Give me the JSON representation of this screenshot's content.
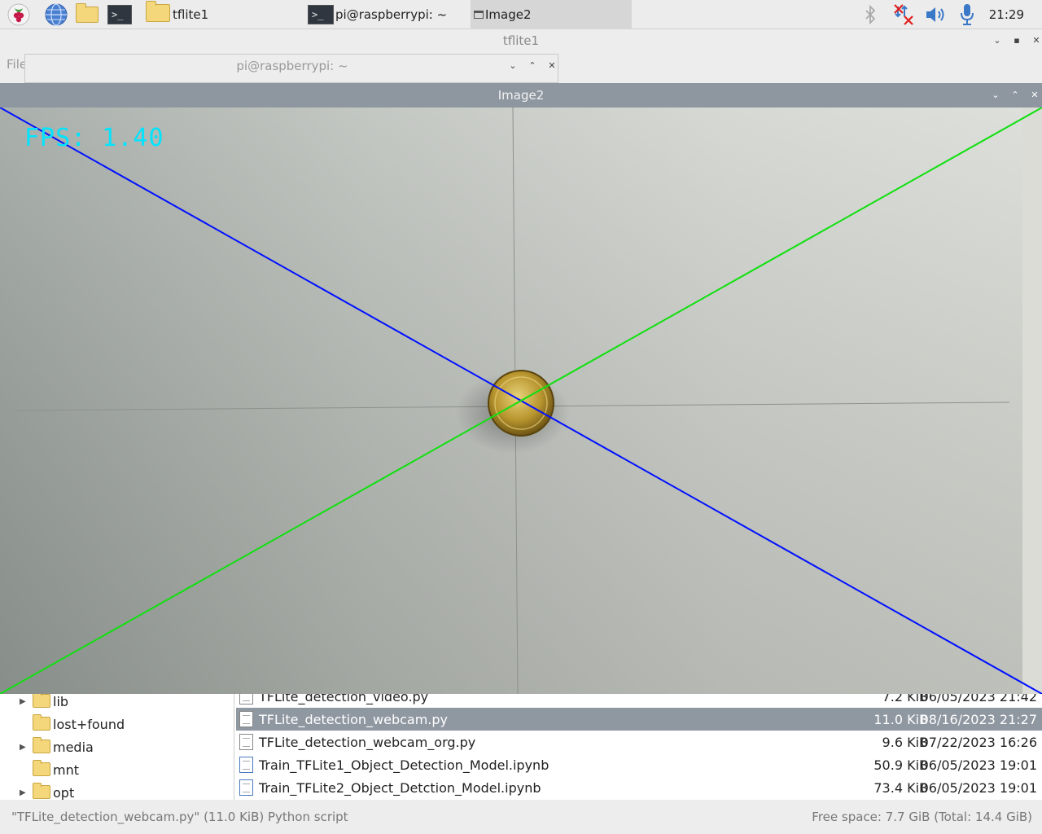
{
  "taskbar": {
    "tasks": [
      {
        "label": "tflite1",
        "icon": "folder-icon"
      },
      {
        "label": "pi@raspberrypi: ~",
        "icon": "terminal-icon"
      },
      {
        "label": "Image2",
        "icon": "window-icon"
      }
    ],
    "terminal_prompt": ">_",
    "clock": "21:29"
  },
  "file_manager": {
    "title": "tflite1",
    "menu_label": "File",
    "tree": [
      {
        "label": "lib",
        "expandable": true
      },
      {
        "label": "lost+found",
        "expandable": false
      },
      {
        "label": "media",
        "expandable": true
      },
      {
        "label": "mnt",
        "expandable": false
      },
      {
        "label": "opt",
        "expandable": true
      }
    ],
    "files": [
      {
        "name": "TFLite_detection_video.py",
        "size": "7.2 KiB",
        "date": "06/05/2023 21:42",
        "selected": false
      },
      {
        "name": "TFLite_detection_webcam.py",
        "size": "11.0 KiB",
        "date": "08/16/2023 21:27",
        "selected": true
      },
      {
        "name": "TFLite_detection_webcam_org.py",
        "size": "9.6 KiB",
        "date": "07/22/2023 16:26",
        "selected": false
      },
      {
        "name": "Train_TFLite1_Object_Detection_Model.ipynb",
        "size": "50.9 KiB",
        "date": "06/05/2023 19:01",
        "selected": false
      },
      {
        "name": "Train_TFLite2_Object_Detction_Model.ipynb",
        "size": "73.4 KiB",
        "date": "06/05/2023 19:01",
        "selected": false
      }
    ],
    "status_left": "\"TFLite_detection_webcam.py\" (11.0 KiB) Python script",
    "status_right": "Free space: 7.7 GiB (Total: 14.4 GiB)"
  },
  "terminal_window": {
    "title": "pi@raspberrypi: ~"
  },
  "image_window": {
    "title": "Image2",
    "fps_text": "FPS: 1.40",
    "colors": {
      "fps": "#00e4ff",
      "diag_blue": "#0010ff",
      "diag_green": "#10e010"
    }
  }
}
